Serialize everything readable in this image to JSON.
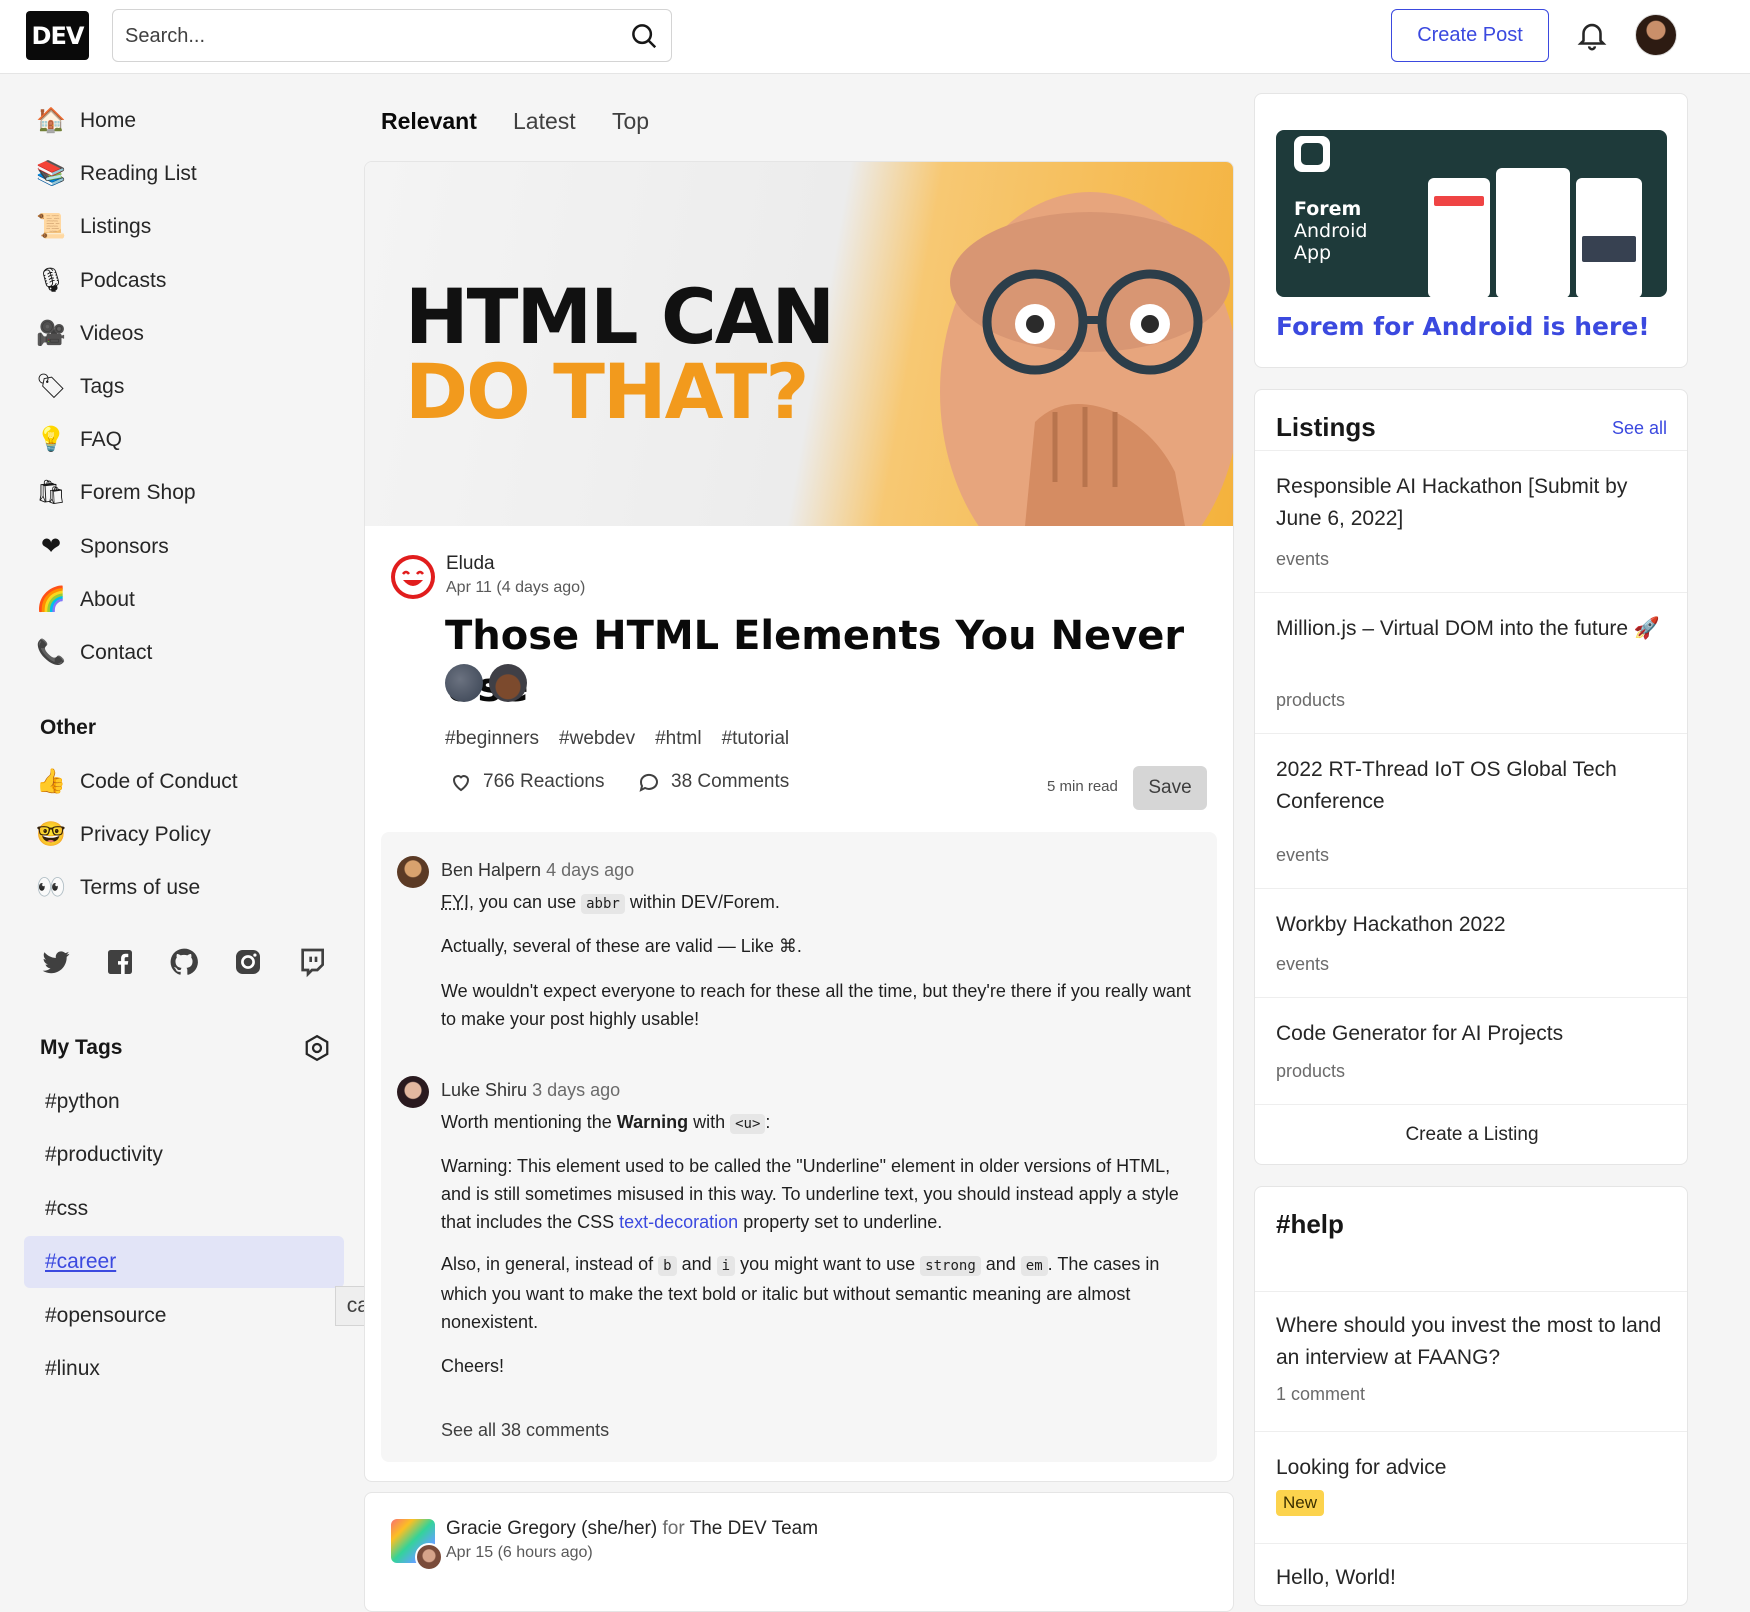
{
  "header": {
    "logo": "DEV",
    "search_placeholder": "Search...",
    "create_post": "Create Post"
  },
  "sidebar": {
    "nav": [
      {
        "label": "Home",
        "icon": "house-icon",
        "glyph": "🏠"
      },
      {
        "label": "Reading List",
        "icon": "reading-list-icon",
        "glyph": "📚"
      },
      {
        "label": "Listings",
        "icon": "scroll-icon",
        "glyph": "📜"
      },
      {
        "label": "Podcasts",
        "icon": "microphone-icon",
        "glyph": "🎙"
      },
      {
        "label": "Videos",
        "icon": "film-camera-icon",
        "glyph": "🎥"
      },
      {
        "label": "Tags",
        "icon": "tag-icon",
        "glyph": "🏷"
      },
      {
        "label": "FAQ",
        "icon": "lightbulb-icon",
        "glyph": "💡"
      },
      {
        "label": "Forem Shop",
        "icon": "shopping-bags-icon",
        "glyph": "🛍"
      },
      {
        "label": "Sponsors",
        "icon": "heart-icon",
        "glyph": "❤"
      },
      {
        "label": "About",
        "icon": "dev-logo-icon",
        "glyph": "🌈"
      },
      {
        "label": "Contact",
        "icon": "contact-icon",
        "glyph": "📞"
      }
    ],
    "other_heading": "Other",
    "other": [
      {
        "label": "Code of Conduct",
        "icon": "thumbs-up-icon",
        "glyph": "👍"
      },
      {
        "label": "Privacy Policy",
        "icon": "nerd-face-icon",
        "glyph": "🤓"
      },
      {
        "label": "Terms of use",
        "icon": "eyes-icon",
        "glyph": "👀"
      }
    ],
    "my_tags_heading": "My Tags",
    "tags": [
      "#python",
      "#productivity",
      "#css",
      "#career",
      "#opensource",
      "#linux"
    ],
    "active_tag_index": 3,
    "tooltip": "career tag"
  },
  "feed": {
    "tabs": [
      "Relevant",
      "Latest",
      "Top"
    ],
    "post": {
      "cover_line1": "HTML CAN",
      "cover_line2": "DO THAT?",
      "author": "Eluda",
      "date": "Apr 11 (4 days ago)",
      "title": "Those HTML Elements You Never Use",
      "tags": [
        "#beginners",
        "#webdev",
        "#html",
        "#tutorial"
      ],
      "reactions": "766 Reactions",
      "comments": "38 Comments",
      "read_time": "5 min read",
      "save": "Save",
      "comment1": {
        "author": "Ben Halpern",
        "when": "4 days ago",
        "p1_abbr": "FYI",
        "p1_a": ", you can use ",
        "p1_code": "abbr",
        "p1_b": " within DEV/Forem.",
        "p2": "Actually, several of these are valid — Like ⌘.",
        "p3": "We wouldn't expect everyone to reach for these all the time, but they're there if you really want to make your post highly usable!"
      },
      "comment2": {
        "author": "Luke Shiru",
        "when": "3 days ago",
        "p1_a": "Worth mentioning the ",
        "p1_strong": "Warning",
        "p1_b": " with ",
        "p1_code": "<u>",
        "p1_c": ":",
        "p2_a": "Warning: This element used to be called the \"Underline\" element in older versions of HTML, and is still sometimes misused in this way. To underline text, you should instead apply a style that includes the CSS ",
        "p2_link": "text-decoration",
        "p2_b": " property set to underline.",
        "p3_a": "Also, in general, instead of ",
        "p3_code1": "b",
        "p3_b": " and ",
        "p3_code2": "i",
        "p3_c": " you might want to use ",
        "p3_code3": "strong",
        "p3_d": " and ",
        "p3_code4": "em",
        "p3_e": ". The cases in which you want to make the text bold or italic but without semantic meaning are almost nonexistent.",
        "p4": "Cheers!"
      },
      "see_all": "See all 38 comments"
    },
    "next_post": {
      "author": "Gracie Gregory (she/her)",
      "for": "for",
      "org": "The DEV Team",
      "date": "Apr 15 (6 hours ago)"
    }
  },
  "right": {
    "ad": {
      "img_line1": "Forem",
      "img_line2": "Android",
      "img_line3": "App",
      "title": "Forem for Android is here!"
    },
    "listings": {
      "heading": "Listings",
      "see_all": "See all",
      "items": [
        {
          "title": "Responsible AI Hackathon [Submit by June 6, 2022]",
          "cat": "events"
        },
        {
          "title": "Million.js – Virtual DOM into the future 🚀",
          "cat": "products"
        },
        {
          "title": "2022 RT-Thread IoT OS Global Tech Conference",
          "cat": "events"
        },
        {
          "title": "Workby Hackathon 2022",
          "cat": "events"
        },
        {
          "title": "Code Generator for AI Projects",
          "cat": "products"
        }
      ],
      "create": "Create a Listing"
    },
    "help": {
      "heading": "#help",
      "items": [
        {
          "title": "Where should you invest the most to land an interview at FAANG?",
          "sub": "1 comment"
        },
        {
          "title": "Looking for advice",
          "badge": "New"
        },
        {
          "title": "Hello, World!"
        }
      ]
    }
  }
}
